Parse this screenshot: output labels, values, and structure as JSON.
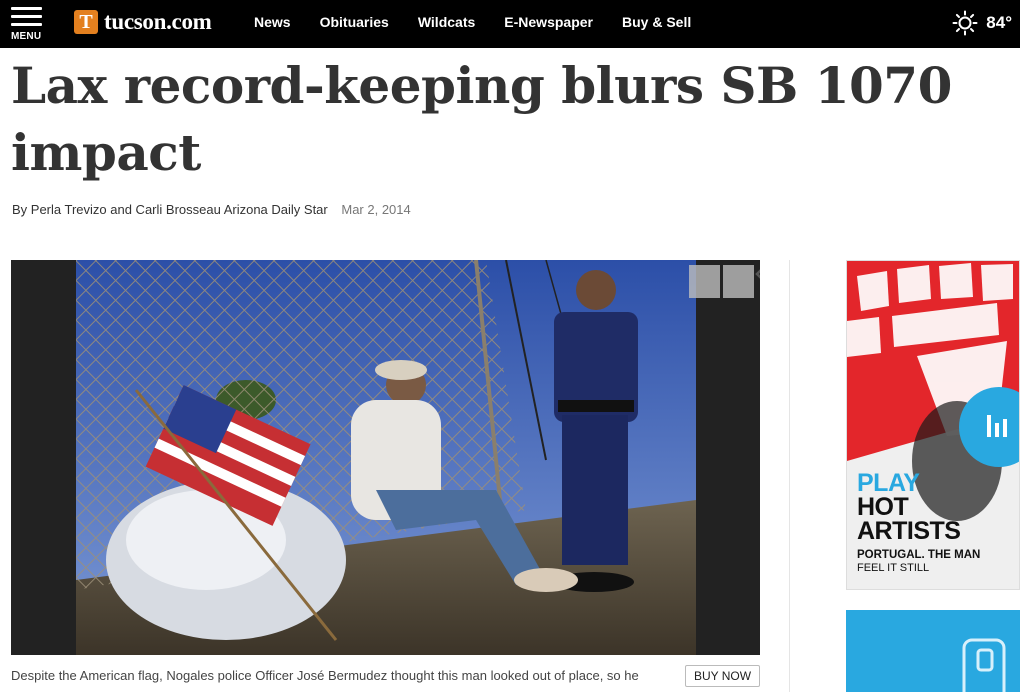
{
  "header": {
    "menu_label": "MENU",
    "logo_mark": "T",
    "logo_text": "tucson.com",
    "nav": [
      "News",
      "Obituaries",
      "Wildcats",
      "E-Newspaper",
      "Buy & Sell"
    ],
    "weather_icon": "sun-icon",
    "temperature": "84°"
  },
  "article": {
    "headline": "Lax record-keeping blurs SB 1070 impact",
    "byline": "By Perla Trevizo and Carli Brosseau Arizona Daily Star",
    "date": "Mar 2, 2014",
    "caption": "Despite the American flag, Nogales police Officer José Bermudez thought this man looked out of place, so he",
    "buy_now": "BUY NOW"
  },
  "gallery": {
    "prev_icon": "chevron-left-icon",
    "next_icon": "chevron-right-icon"
  },
  "ad": {
    "line1": "PLAY",
    "line2": "HOT",
    "line3": "ARTISTS",
    "band": "PORTUGAL. THE MAN",
    "song": "FEEL IT STILL",
    "accent": "#29a8e0",
    "red": "#e3262b"
  }
}
